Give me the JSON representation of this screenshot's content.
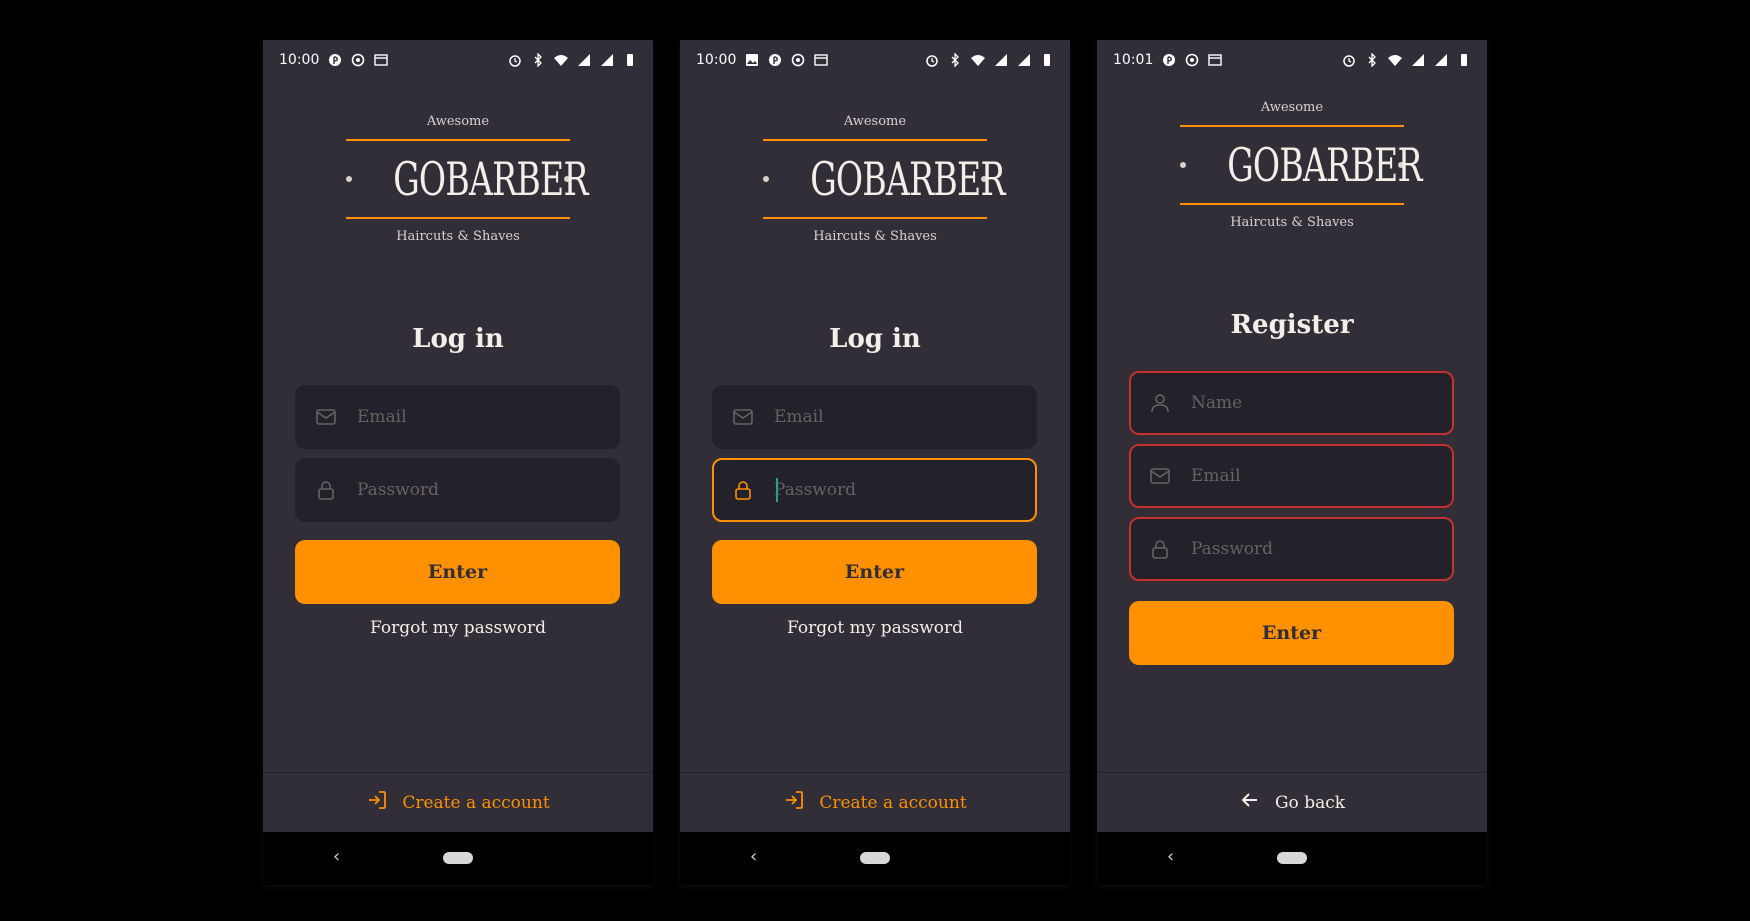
{
  "colors": {
    "background": "#000000",
    "screen": "#312e38",
    "input_bg": "#232129",
    "accent": "#ff9000",
    "error": "#c53030",
    "text": "#f4ede8",
    "placeholder": "#666360"
  },
  "logo": {
    "top_text": "Awesome",
    "brand": "GOBARBER",
    "bottom_text": "Haircuts & Shaves"
  },
  "screens": [
    {
      "status": {
        "time": "10:00"
      },
      "title": "Log in",
      "fields": [
        {
          "icon": "mail-icon",
          "placeholder": "Email",
          "state": "default"
        },
        {
          "icon": "lock-icon",
          "placeholder": "Password",
          "state": "default"
        }
      ],
      "button_label": "Enter",
      "forgot_label": "Forgot my password",
      "footer": {
        "icon": "log-in-icon",
        "label": "Create a account"
      }
    },
    {
      "status": {
        "time": "10:00"
      },
      "title": "Log in",
      "fields": [
        {
          "icon": "mail-icon",
          "placeholder": "Email",
          "state": "default"
        },
        {
          "icon": "lock-icon",
          "placeholder": "Password",
          "state": "focused"
        }
      ],
      "button_label": "Enter",
      "forgot_label": "Forgot my password",
      "footer": {
        "icon": "log-in-icon",
        "label": "Create a account"
      }
    },
    {
      "status": {
        "time": "10:01"
      },
      "title": "Register",
      "fields": [
        {
          "icon": "user-icon",
          "placeholder": "Name",
          "state": "error"
        },
        {
          "icon": "mail-icon",
          "placeholder": "Email",
          "state": "error"
        },
        {
          "icon": "lock-icon",
          "placeholder": "Password",
          "state": "error"
        }
      ],
      "button_label": "Enter",
      "footer": {
        "icon": "arrow-left-icon",
        "label": "Go back"
      }
    }
  ],
  "nav": {
    "back_glyph": "‹"
  }
}
